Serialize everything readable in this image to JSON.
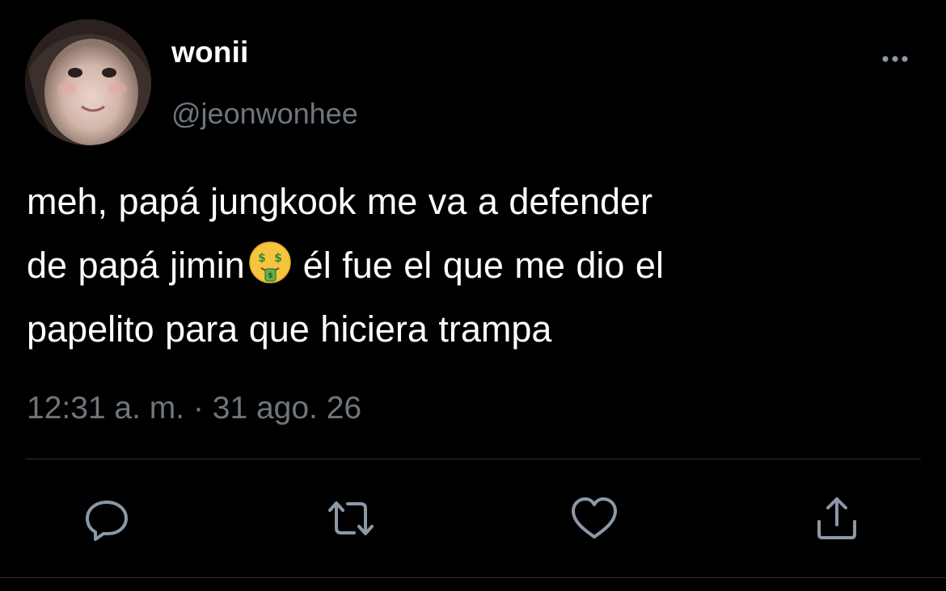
{
  "tweet": {
    "author": {
      "display_name": "wonii",
      "handle": "@jeonwonhee"
    },
    "text_lines": [
      "meh, papá jungkook me va a defender",
      "de papá jimin",
      "él fue el que me dio el",
      "papelito para que hiciera trampa"
    ],
    "emoji": "money-mouth-face",
    "timestamp": "12:31 a. m. · 31 ago. 26"
  },
  "icons": {
    "more": "more-horizontal-icon",
    "reply": "reply-icon",
    "retweet": "retweet-icon",
    "like": "like-icon",
    "share": "share-icon"
  },
  "colors": {
    "background": "#000000",
    "text_primary": "#ffffff",
    "text_secondary": "#6e767d",
    "icon": "#8b98a5",
    "divider": "#2f3336"
  }
}
